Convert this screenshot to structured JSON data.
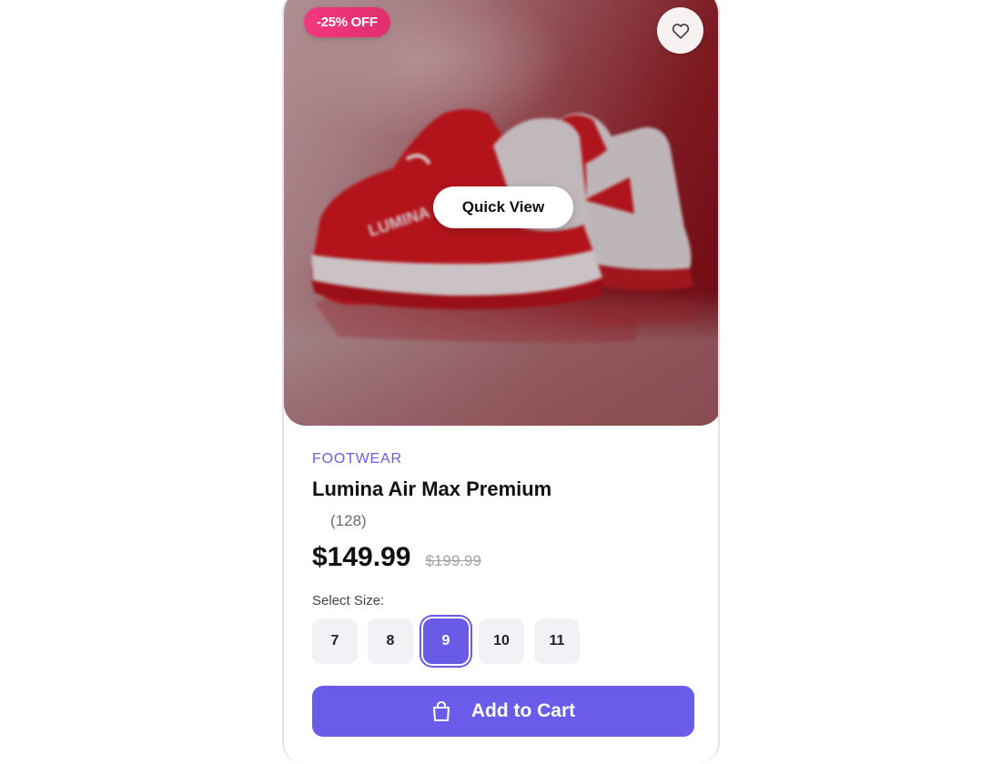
{
  "product": {
    "badge": "-25% OFF",
    "quick_view_label": "Quick View",
    "category": "FOOTWEAR",
    "name": "Lumina Air Max Premium",
    "review_count": "(128)",
    "price": "$149.99",
    "original_price": "$199.99",
    "shoe_brand_text": "LUMINA"
  },
  "sizes": {
    "label": "Select Size:",
    "options": [
      "7",
      "8",
      "9",
      "10",
      "11"
    ],
    "selected": "9"
  },
  "actions": {
    "add_to_cart_label": "Add to Cart"
  },
  "icons": {
    "wishlist": "heart-icon",
    "cart": "shopping-bag-icon"
  },
  "colors": {
    "accent": "#6b5bea",
    "category_text": "#6c5ce7",
    "badge": "#e8336f",
    "image_background": "#7a0611"
  }
}
